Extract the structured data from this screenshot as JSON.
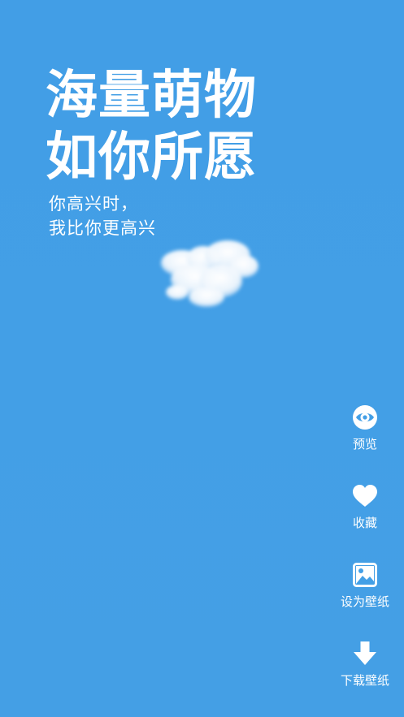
{
  "headline": {
    "line1": "海量萌物",
    "line2": "如你所愿"
  },
  "subline": {
    "line1": "你高兴时，",
    "line2": "我比你更高兴"
  },
  "colors": {
    "background": "#439FE6",
    "foreground": "#FFFFFF"
  },
  "actions": [
    {
      "label": "预览",
      "icon": "eye-icon"
    },
    {
      "label": "收藏",
      "icon": "heart-icon"
    },
    {
      "label": "设为壁纸",
      "icon": "image-icon"
    },
    {
      "label": "下载壁纸",
      "icon": "download-arrow-icon"
    }
  ]
}
